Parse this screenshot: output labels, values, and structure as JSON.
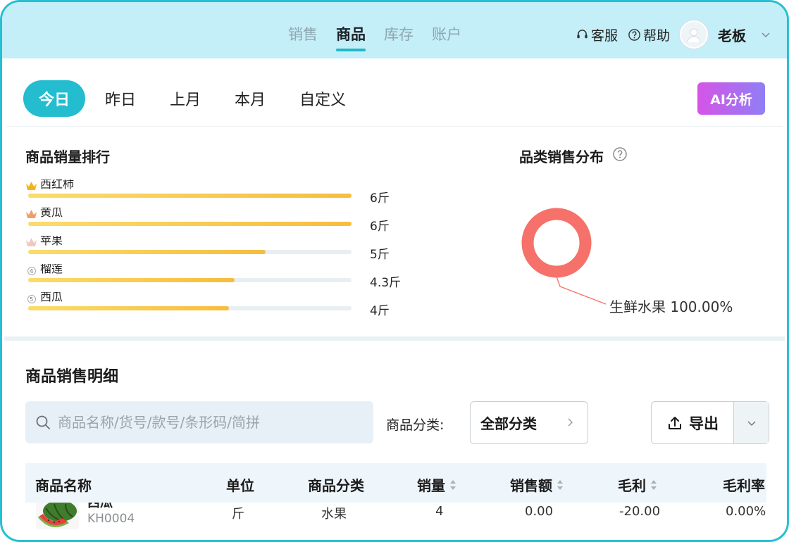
{
  "topnav": {
    "tabs": [
      {
        "label": "销售",
        "active": false
      },
      {
        "label": "商品",
        "active": true
      },
      {
        "label": "库存",
        "active": false
      },
      {
        "label": "账户",
        "active": false
      }
    ],
    "service_label": "客服",
    "help_label": "帮助",
    "user_name": "老板"
  },
  "date_filter": {
    "options": [
      "今日",
      "昨日",
      "上月",
      "本月",
      "自定义"
    ],
    "selected": "今日"
  },
  "ai_button_label": "AI分析",
  "ranking": {
    "title": "商品销量排行",
    "items": [
      {
        "rank": 1,
        "name": "西红柿",
        "value": 6,
        "value_label": "6斤",
        "icon": "crown-gold-icon"
      },
      {
        "rank": 2,
        "name": "黄瓜",
        "value": 6,
        "value_label": "6斤",
        "icon": "crown-orange-icon"
      },
      {
        "rank": 3,
        "name": "苹果",
        "value": 5,
        "value_label": "5斤",
        "icon": "crown-pink-icon"
      },
      {
        "rank": 4,
        "name": "榴莲",
        "value": 4.3,
        "value_label": "4.3斤",
        "icon": "rank-number-icon"
      },
      {
        "rank": 5,
        "name": "西瓜",
        "value": 4,
        "value_label": "4斤",
        "icon": "rank-number-icon"
      }
    ],
    "max_value": 6
  },
  "category_distribution": {
    "title": "品类销售分布",
    "chart_data": {
      "type": "pie",
      "slices": [
        {
          "name": "生鲜水果",
          "value": 100.0,
          "label": "生鲜水果 100.00%"
        }
      ]
    },
    "color": "#f5716a"
  },
  "detail": {
    "title": "商品销售明细",
    "search_placeholder": "商品名称/货号/款号/条形码/简拼",
    "category_label": "商品分类:",
    "category_value": "全部分类",
    "export_label": "导出",
    "columns": [
      "商品名称",
      "单位",
      "商品分类",
      "销量",
      "销售额",
      "毛利",
      "毛利率"
    ],
    "rows": [
      {
        "name": "西瓜",
        "code": "KH0004",
        "unit": "斤",
        "category": "水果",
        "qty": "4",
        "sales": "0.00",
        "profit": "-20.00",
        "margin": "0.00%"
      }
    ]
  },
  "colors": {
    "accent": "#24bdd0",
    "topbar_bg": "#c4eef8",
    "bar_start": "#fbdc6b",
    "bar_end": "#f6bd3e"
  }
}
